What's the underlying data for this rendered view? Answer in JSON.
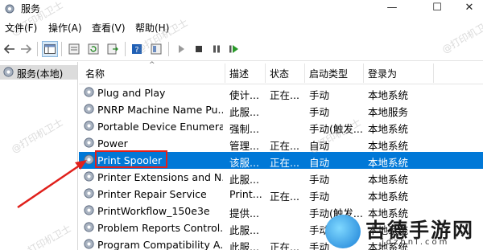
{
  "window": {
    "title": "服务",
    "min_glyph": "—",
    "max_glyph": "☐",
    "close_glyph": "✕"
  },
  "menu": [
    "文件(F)",
    "操作(A)",
    "查看(V)",
    "帮助(H)"
  ],
  "left_pane": {
    "item": "服务(本地)"
  },
  "columns": {
    "name": "名称",
    "desc": "描述",
    "status": "状态",
    "startup": "启动类型",
    "logon": "登录为"
  },
  "services": [
    {
      "name": "Plug and Play",
      "desc": "使计...",
      "status": "正在...",
      "startup": "手动",
      "logon": "本地系统"
    },
    {
      "name": "PNRP Machine Name Pu...",
      "desc": "此服...",
      "status": "",
      "startup": "手动",
      "logon": "本地服务"
    },
    {
      "name": "Portable Device Enumera...",
      "desc": "强制...",
      "status": "",
      "startup": "手动(触发...",
      "logon": "本地系统"
    },
    {
      "name": "Power",
      "desc": "管理...",
      "status": "正在...",
      "startup": "自动",
      "logon": "本地系统"
    },
    {
      "name": "Print Spooler",
      "desc": "该服...",
      "status": "正在...",
      "startup": "自动",
      "logon": "本地系统"
    },
    {
      "name": "Printer Extensions and N...",
      "desc": "此服...",
      "status": "",
      "startup": "手动",
      "logon": "本地系统"
    },
    {
      "name": "Printer Repair Service",
      "desc": "Print...",
      "status": "正在...",
      "startup": "手动",
      "logon": "本地系统"
    },
    {
      "name": "PrintWorkflow_150e3e",
      "desc": "提供...",
      "status": "",
      "startup": "手动(触发...",
      "logon": "本地系统"
    },
    {
      "name": "Problem Reports Control...",
      "desc": "此服...",
      "status": "",
      "startup": "手动",
      "logon": "本地系统"
    },
    {
      "name": "Program Compatibility A...",
      "desc": "此服...",
      "status": "正在...",
      "startup": "手动",
      "logon": "本地系统"
    }
  ],
  "selected_index": 4,
  "watermark": "@打印机卫士",
  "logo": {
    "name": "吉德手游网",
    "url": "jdzhnl.com"
  },
  "colors": {
    "selection": "#0078d7",
    "highlight_box": "#e0201b"
  }
}
